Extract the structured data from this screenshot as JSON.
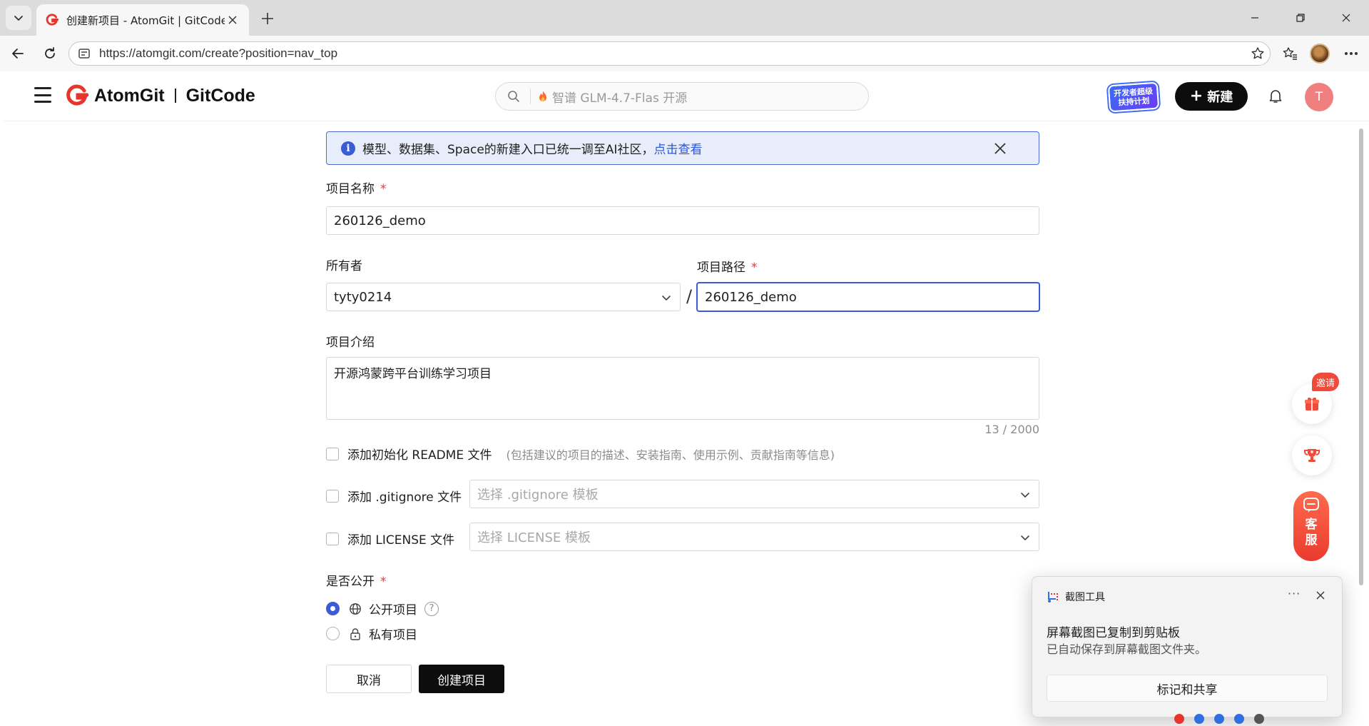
{
  "browser": {
    "tab_title": "创建新项目 - AtomGit | GitCode",
    "url": "https://atomgit.com/create?position=nav_top"
  },
  "header": {
    "brand_left": "AtomGit",
    "brand_right": "GitCode",
    "search_placeholder": "智谱 GLM-4.7-Flas 开源",
    "new_button": "新建",
    "avatar_letter": "T",
    "promo_badge": "开发者超级扶持计划"
  },
  "notice": {
    "text": "模型、数据集、Space的新建入口已统一调至AI社区，",
    "link": "点击查看"
  },
  "form": {
    "name_label": "项目名称",
    "name_value": "260126_demo",
    "owner_label": "所有者",
    "owner_value": "tyty0214",
    "path_label": "项目路径",
    "path_value": "260126_demo",
    "separator": "/",
    "desc_label": "项目介绍",
    "desc_value": "开源鸿蒙跨平台训练学习项目",
    "desc_counter": "13 / 2000",
    "readme_label": "添加初始化 README 文件",
    "readme_hint": "(包括建议的项目的描述、安装指南、使用示例、贡献指南等信息)",
    "gitignore_label": "添加 .gitignore 文件",
    "gitignore_placeholder": "选择 .gitignore 模板",
    "license_label": "添加 LICENSE 文件",
    "license_placeholder": "选择 LICENSE 模板",
    "visibility_label": "是否公开",
    "required_mark": "*",
    "public_label": "公开项目",
    "private_label": "私有项目",
    "help_mark": "?",
    "cancel_button": "取消",
    "create_button": "创建项目"
  },
  "floating": {
    "invite_tag": "邀请",
    "service_text": "客服"
  },
  "toast": {
    "app_name": "截图工具",
    "more": "···",
    "title": "屏幕截图已复制到剪贴板",
    "subtitle": "已自动保存到屏幕截图文件夹。",
    "action": "标记和共享"
  },
  "colors": {
    "accent": "#3c5bd6",
    "brand_red": "#e8352b",
    "required": "#e53935",
    "button_dark": "#0d0d0d"
  },
  "icons": [
    "chevron-down-icon",
    "close-icon",
    "plus-icon",
    "back-icon",
    "refresh-icon",
    "site-info-icon",
    "star-icon",
    "favorites-icon",
    "more-icon",
    "search-icon",
    "fire-icon",
    "bell-icon",
    "info-icon",
    "globe-icon",
    "lock-icon",
    "gift-icon",
    "trophy-icon",
    "headset-icon",
    "snip-icon"
  ]
}
